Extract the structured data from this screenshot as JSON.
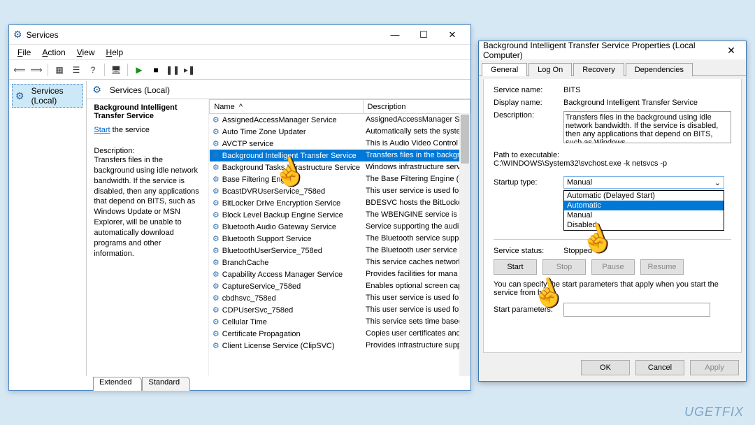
{
  "services_window": {
    "title": "Services",
    "menus": {
      "file": "File",
      "action": "Action",
      "view": "View",
      "help": "Help"
    },
    "tree_item": "Services (Local)",
    "right_header": "Services (Local)",
    "selected_service": {
      "title": "Background Intelligent Transfer Service",
      "action_link": "Start",
      "action_suffix": " the service",
      "desc_label": "Description:",
      "desc_text": "Transfers files in the background using idle network bandwidth. If the service is disabled, then any applications that depend on BITS, such as Windows Update or MSN Explorer, will be unable to automatically download programs and other information."
    },
    "columns": {
      "name": "Name",
      "description": "Description"
    },
    "services": [
      {
        "name": "AssignedAccessManager Service",
        "desc": "AssignedAccessManager Se"
      },
      {
        "name": "Auto Time Zone Updater",
        "desc": "Automatically sets the syste"
      },
      {
        "name": "AVCTP service",
        "desc": "This is Audio Video Control"
      },
      {
        "name": "Background Intelligent Transfer Service",
        "desc": "Transfers files in the backgr",
        "selected": true
      },
      {
        "name": "Background Tasks Infrastructure Service",
        "desc": "Windows infrastructure serv"
      },
      {
        "name": "Base Filtering Engine",
        "desc": "The Base Filtering Engine (B"
      },
      {
        "name": "BcastDVRUserService_758ed",
        "desc": "This user service is used for"
      },
      {
        "name": "BitLocker Drive Encryption Service",
        "desc": "BDESVC hosts the BitLocker"
      },
      {
        "name": "Block Level Backup Engine Service",
        "desc": "The WBENGINE service is us"
      },
      {
        "name": "Bluetooth Audio Gateway Service",
        "desc": "Service supporting the audi"
      },
      {
        "name": "Bluetooth Support Service",
        "desc": "The Bluetooth service suppo"
      },
      {
        "name": "BluetoothUserService_758ed",
        "desc": "The Bluetooth user service s"
      },
      {
        "name": "BranchCache",
        "desc": "This service caches network"
      },
      {
        "name": "Capability Access Manager Service",
        "desc": "Provides facilities for mana"
      },
      {
        "name": "CaptureService_758ed",
        "desc": "Enables optional screen cap"
      },
      {
        "name": "cbdhsvc_758ed",
        "desc": "This user service is used for"
      },
      {
        "name": "CDPUserSvc_758ed",
        "desc": "This user service is used for"
      },
      {
        "name": "Cellular Time",
        "desc": "This service sets time based"
      },
      {
        "name": "Certificate Propagation",
        "desc": "Copies user certificates and"
      },
      {
        "name": "Client License Service (ClipSVC)",
        "desc": "Provides infrastructure supp"
      }
    ],
    "bottom_tabs": {
      "extended": "Extended",
      "standard": "Standard"
    }
  },
  "props_dialog": {
    "title": "Background Intelligent Transfer Service Properties (Local Computer)",
    "tabs": {
      "general": "General",
      "logon": "Log On",
      "recovery": "Recovery",
      "dependencies": "Dependencies"
    },
    "labels": {
      "service_name": "Service name:",
      "display_name": "Display name:",
      "description": "Description:",
      "path": "Path to executable:",
      "startup_type": "Startup type:",
      "service_status": "Service status:",
      "start_params": "Start parameters:",
      "hint": "You can specify the start parameters that apply when you start the service from here."
    },
    "values": {
      "service_name": "BITS",
      "display_name": "Background Intelligent Transfer Service",
      "description": "Transfers files in the background using idle network bandwidth. If the service is disabled, then any applications that depend on BITS, such as Windows",
      "path": "C:\\WINDOWS\\System32\\svchost.exe -k netsvcs -p",
      "startup_selected": "Manual",
      "service_status": "Stopped"
    },
    "dropdown_options": [
      "Automatic (Delayed Start)",
      "Automatic",
      "Manual",
      "Disabled"
    ],
    "buttons": {
      "start": "Start",
      "stop": "Stop",
      "pause": "Pause",
      "resume": "Resume",
      "ok": "OK",
      "cancel": "Cancel",
      "apply": "Apply"
    }
  },
  "watermark": "UGETFIX"
}
